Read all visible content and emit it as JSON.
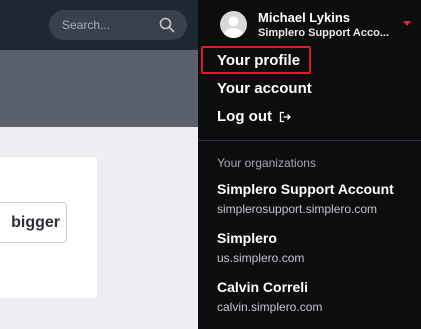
{
  "search": {
    "placeholder": "Search..."
  },
  "background": {
    "button_label": "bigger"
  },
  "user": {
    "name": "Michael Lykins",
    "org": "Simplero Support Acco..."
  },
  "menu": {
    "items": [
      {
        "label": "Your profile"
      },
      {
        "label": "Your account"
      },
      {
        "label": "Log out"
      }
    ]
  },
  "organizations": {
    "heading": "Your organizations",
    "items": [
      {
        "name": "Simplero Support Account",
        "url": "simplerosupport.simplero.com"
      },
      {
        "name": "Simplero",
        "url": "us.simplero.com"
      },
      {
        "name": "Calvin Correli",
        "url": "calvin.simplero.com"
      }
    ]
  },
  "colors": {
    "topbar": "#1f2732",
    "menu_bg": "#0c0d0f",
    "highlight": "#e21a23",
    "caret": "#e0283a"
  }
}
